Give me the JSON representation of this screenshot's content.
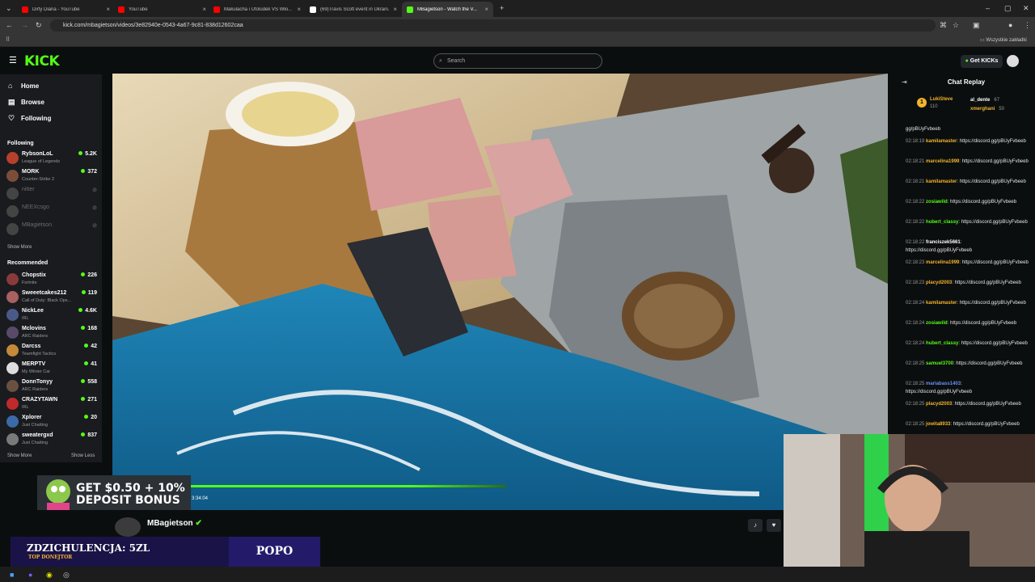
{
  "browser": {
    "tabs": [
      {
        "title": "Dirty Diana - YouTube",
        "color": "#ff0000"
      },
      {
        "title": "YouTube",
        "color": "#ff0000"
      },
      {
        "title": "Makulacha i Ufoludek VS Wło...",
        "color": "#ff0000"
      },
      {
        "title": "(69)Travis Scott event in Ukrain...",
        "color": "#ffffff"
      },
      {
        "title": "MBagietson - Watch the V...",
        "color": "#53fc18"
      }
    ],
    "url": "kick.com/mbagietson/videos/3e82940e-0543-4a67-9c81-838d12602caa",
    "bookmarks_label": "Wszystkie zakładki"
  },
  "header": {
    "logo": "KICK",
    "search_placeholder": "Search",
    "get_kicks": "Get KICKs"
  },
  "sidebar": {
    "nav": [
      {
        "label": "Home",
        "icon": "home-icon"
      },
      {
        "label": "Browse",
        "icon": "browse-icon"
      },
      {
        "label": "Following",
        "icon": "heart-icon"
      }
    ],
    "following_title": "Following",
    "following": [
      {
        "name": "RybsonLoL",
        "category": "League of Legends",
        "viewers": "5.2K",
        "color": "#b7402c",
        "live": true
      },
      {
        "name": "MORK",
        "category": "Counter-Strike 2",
        "viewers": "372",
        "color": "#7a4e39",
        "live": true
      },
      {
        "name": "nitter",
        "category": "",
        "viewers": "",
        "color": "#444",
        "live": false
      },
      {
        "name": "NEEXcsgo",
        "category": "",
        "viewers": "",
        "color": "#444",
        "live": false
      },
      {
        "name": "MBagietson",
        "category": "",
        "viewers": "",
        "color": "#444",
        "live": false
      }
    ],
    "show_more": "Show More",
    "recommended_title": "Recommended",
    "recommended": [
      {
        "name": "Chopstix",
        "category": "Fortnite",
        "viewers": "226",
        "color": "#8a3a3a"
      },
      {
        "name": "Sweeetcakes212",
        "category": "Call of Duty: Black Ops...",
        "viewers": "119",
        "color": "#a86060"
      },
      {
        "name": "NickLee",
        "category": "IRL",
        "viewers": "4.6K",
        "color": "#4a5a88"
      },
      {
        "name": "Mclovins",
        "category": "ARC Raiders",
        "viewers": "168",
        "color": "#5a4a6a"
      },
      {
        "name": "Darcss",
        "category": "Teamfight Tactics",
        "viewers": "42",
        "color": "#c48a3a"
      },
      {
        "name": "MERPTV",
        "category": "My Winter Car",
        "viewers": "41",
        "color": "#ddd"
      },
      {
        "name": "DonnTonyy",
        "category": "ARC Raiders",
        "viewers": "558",
        "color": "#6a5040"
      },
      {
        "name": "CRAZYTAWN",
        "category": "IRL",
        "viewers": "271",
        "color": "#c02a2a"
      },
      {
        "name": "Xplorer",
        "category": "Just Chatting",
        "viewers": "20",
        "color": "#3a6aa8"
      },
      {
        "name": "sweatergxd",
        "category": "Just Chatting",
        "viewers": "837",
        "color": "#7a7a7a"
      }
    ],
    "show_more_2": "Show More",
    "show_less": "Show Less"
  },
  "chat": {
    "title": "Chat Replay",
    "top_gifters": [
      {
        "name": "LukiSteve",
        "count": "110"
      },
      {
        "name": "al_dente",
        "count": "67"
      },
      {
        "name": "xmerghani",
        "count": "50"
      }
    ],
    "first_line": "gg/pBUyFvbeeb",
    "messages": [
      {
        "time": "02:18:19",
        "user": "kamilamaster",
        "color": "#f2b32d",
        "text": "https://discord.gg/pBUyFvbeeb"
      },
      {
        "time": "02:18:21",
        "user": "marcelina1999",
        "color": "#f2b32d",
        "text": "https://discord.gg/pBUyFvbeeb"
      },
      {
        "time": "02:18:21",
        "user": "kamilamaster",
        "color": "#f2b32d",
        "text": "https://discord.gg/pBUyFvbeeb"
      },
      {
        "time": "02:18:22",
        "user": "zosiawild",
        "color": "#53fc18",
        "text": "https://discord.gg/pBUyFvbeeb"
      },
      {
        "time": "02:18:22",
        "user": "hubert_classy",
        "color": "#53fc18",
        "text": "https://discord.gg/pBUyFvbeeb"
      },
      {
        "time": "02:18:22",
        "user": "franciszek5661",
        "color": "#ffffff",
        "text": "https://discord.gg/pBUyFvbeeb"
      },
      {
        "time": "02:18:23",
        "user": "marcelina1999",
        "color": "#f2b32d",
        "text": "https://discord.gg/pBUyFvbeeb"
      },
      {
        "time": "02:18:23",
        "user": "placyd2003",
        "color": "#f2b32d",
        "text": "https://discord.gg/pBUyFvbeeb"
      },
      {
        "time": "02:18:24",
        "user": "kamilamaster",
        "color": "#f2b32d",
        "text": "https://discord.gg/pBUyFvbeeb"
      },
      {
        "time": "02:18:24",
        "user": "zosiawild",
        "color": "#53fc18",
        "text": "https://discord.gg/pBUyFvbeeb"
      },
      {
        "time": "02:18:24",
        "user": "hubert_classy",
        "color": "#53fc18",
        "text": "https://discord.gg/pBUyFvbeeb"
      },
      {
        "time": "02:18:25",
        "user": "samuel3700",
        "color": "#53fc18",
        "text": "https://discord.gg/pBUyFvbeeb"
      },
      {
        "time": "02:18:25",
        "user": "mariabass1403",
        "color": "#6e8cf5",
        "text": "https://discord.gg/pBUyFvbeeb"
      },
      {
        "time": "02:18:25",
        "user": "placyd2003",
        "color": "#f2b32d",
        "text": "https://discord.gg/pBUyFvbeeb"
      },
      {
        "time": "02:18:25",
        "user": "jowita8933",
        "color": "#f2b32d",
        "text": "https://discord.gg/pBUyFvbeeb"
      }
    ]
  },
  "player": {
    "elapsed": "3:34:04",
    "progress": 0.7
  },
  "stream": {
    "streamer": "MBagietson"
  },
  "overlay": {
    "ad_line1": "GET $0.50 + 10%",
    "ad_line2": "DEPOSIT BONUS",
    "donation_title": "ZDZICHULENCJA: 5ZL",
    "donation_sub": "TOP DONEJTOR",
    "popo": "POPO"
  }
}
